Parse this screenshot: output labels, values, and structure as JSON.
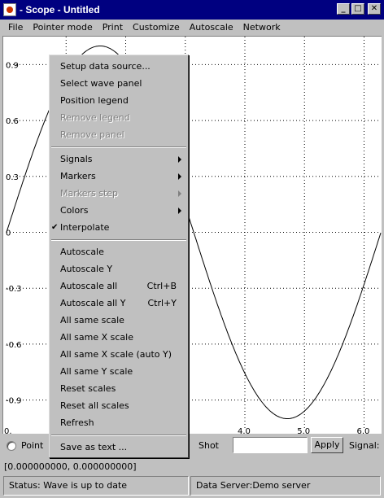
{
  "window": {
    "title": "- Scope - Untitled",
    "minimize": "_",
    "maximize": "□",
    "close": "✕"
  },
  "menubar": [
    "File",
    "Pointer mode",
    "Print",
    "Customize",
    "Autoscale",
    "Network"
  ],
  "plot": {
    "y_ticks": [
      "0.9",
      "0.6",
      "0.3",
      "0",
      "-0.3",
      "-0.6",
      "-0.9"
    ],
    "x_ticks": [
      "0.",
      "4.0",
      "5.0",
      "6.0"
    ],
    "signal": "sine",
    "x_range": [
      0,
      6.28
    ],
    "y_range": [
      -1.05,
      1.05
    ],
    "grid": true,
    "line_color": "#000000"
  },
  "context_menu": [
    {
      "label": "Setup data source...",
      "enabled": true
    },
    {
      "label": "Select wave panel",
      "enabled": true
    },
    {
      "label": "Position legend",
      "enabled": true
    },
    {
      "label": "Remove legend",
      "enabled": false
    },
    {
      "label": "Remove panel",
      "enabled": false
    },
    {
      "separator": true
    },
    {
      "label": "Signals",
      "enabled": true,
      "submenu": true
    },
    {
      "label": "Markers",
      "enabled": true,
      "submenu": true
    },
    {
      "label": "Markers step",
      "enabled": false,
      "submenu": true
    },
    {
      "label": "Colors",
      "enabled": true,
      "submenu": true
    },
    {
      "label": "Interpolate",
      "enabled": true,
      "checked": true
    },
    {
      "separator": true
    },
    {
      "label": "Autoscale",
      "enabled": true
    },
    {
      "label": "Autoscale Y",
      "enabled": true
    },
    {
      "label": "Autoscale all",
      "enabled": true,
      "accel": "Ctrl+B"
    },
    {
      "label": "Autoscale all Y",
      "enabled": true,
      "accel": "Ctrl+Y"
    },
    {
      "label": "All same scale",
      "enabled": true
    },
    {
      "label": "All same X scale",
      "enabled": true
    },
    {
      "label": "All same X scale (auto Y)",
      "enabled": true
    },
    {
      "label": "All same Y scale",
      "enabled": true
    },
    {
      "label": "Reset scales",
      "enabled": true
    },
    {
      "label": "Reset all scales",
      "enabled": true
    },
    {
      "label": "Refresh",
      "enabled": true
    },
    {
      "separator": true
    },
    {
      "label": "Save as text ...",
      "enabled": true
    }
  ],
  "controls": {
    "point_label": "Point",
    "shot_label": "Shot",
    "shot_value": "",
    "apply_label": "Apply",
    "signal_label": "Signal:"
  },
  "coords": "[0.000000000, 0.000000000]",
  "status": {
    "left": "Status: Wave is up to date",
    "right": "Data Server:Demo server"
  }
}
